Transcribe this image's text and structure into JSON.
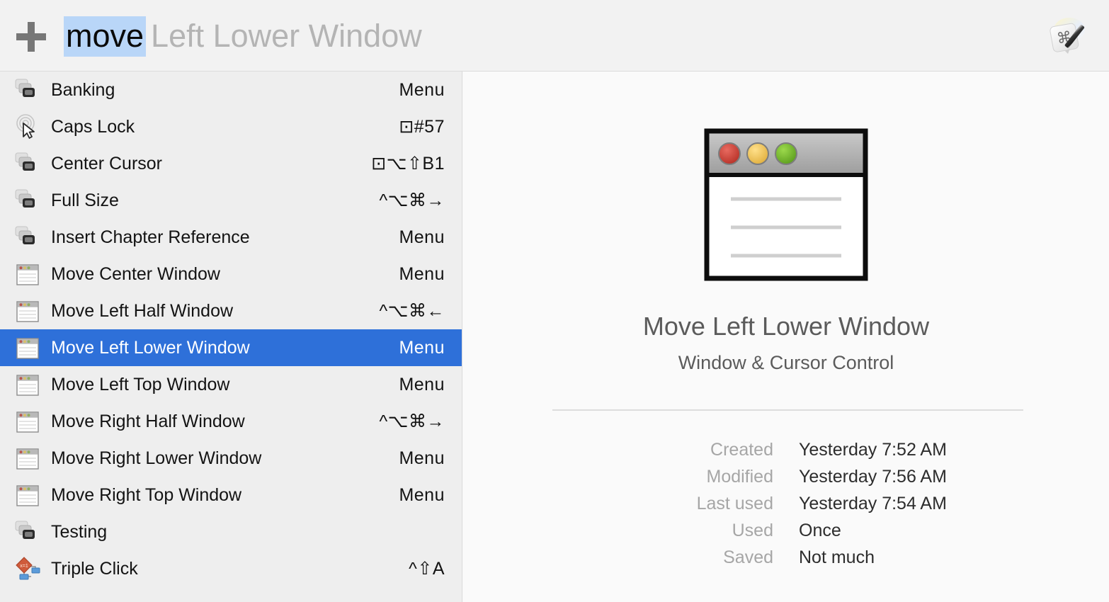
{
  "header": {
    "add_icon": "plus-icon",
    "search_typed": "move",
    "search_completion": "Left Lower Window",
    "app_icon": "keyboard-maestro-app-icon"
  },
  "colors": {
    "selection_blue": "#2e70d9",
    "search_highlight": "#b9d6f8",
    "list_background": "#eeeeee",
    "detail_background": "#fafafa",
    "header_background": "#f2f2f2"
  },
  "list": {
    "items": [
      {
        "label": "Banking",
        "trigger": "Menu",
        "icon": "macro-group-stack-icon"
      },
      {
        "label": "Caps Lock",
        "trigger": "⊡#57",
        "icon": "cursor-ripple-icon"
      },
      {
        "label": "Center Cursor",
        "trigger": "⊡⌥⇧B1",
        "icon": "macro-group-stack-icon"
      },
      {
        "label": "Full Size",
        "trigger": "^⌥⌘→",
        "icon": "macro-group-stack-icon"
      },
      {
        "label": "Insert Chapter Reference",
        "trigger": "Menu",
        "icon": "macro-group-stack-icon"
      },
      {
        "label": "Move Center Window",
        "trigger": "Menu",
        "icon": "window-icon"
      },
      {
        "label": "Move Left Half Window",
        "trigger": "^⌥⌘←",
        "icon": "window-icon"
      },
      {
        "label": "Move Left Lower Window",
        "trigger": "Menu",
        "icon": "window-icon",
        "selected": true
      },
      {
        "label": "Move Left Top Window",
        "trigger": "Menu",
        "icon": "window-icon"
      },
      {
        "label": "Move Right Half Window",
        "trigger": "^⌥⌘→",
        "icon": "window-icon"
      },
      {
        "label": "Move Right Lower Window",
        "trigger": "Menu",
        "icon": "window-icon"
      },
      {
        "label": "Move Right Top Window",
        "trigger": "Menu",
        "icon": "window-icon"
      },
      {
        "label": "Testing",
        "trigger": "",
        "icon": "macro-group-stack-icon"
      },
      {
        "label": "Triple Click",
        "trigger": "^⇧A",
        "icon": "flowchart-diamond-icon"
      }
    ]
  },
  "detail": {
    "icon": "window-large-icon",
    "title": "Move Left Lower Window",
    "subtitle": "Window & Cursor Control",
    "meta": [
      {
        "key": "Created",
        "value": "Yesterday 7:52 AM"
      },
      {
        "key": "Modified",
        "value": "Yesterday 7:56 AM"
      },
      {
        "key": "Last used",
        "value": "Yesterday 7:54 AM"
      },
      {
        "key": "Used",
        "value": "Once"
      },
      {
        "key": "Saved",
        "value": "Not much"
      }
    ]
  }
}
